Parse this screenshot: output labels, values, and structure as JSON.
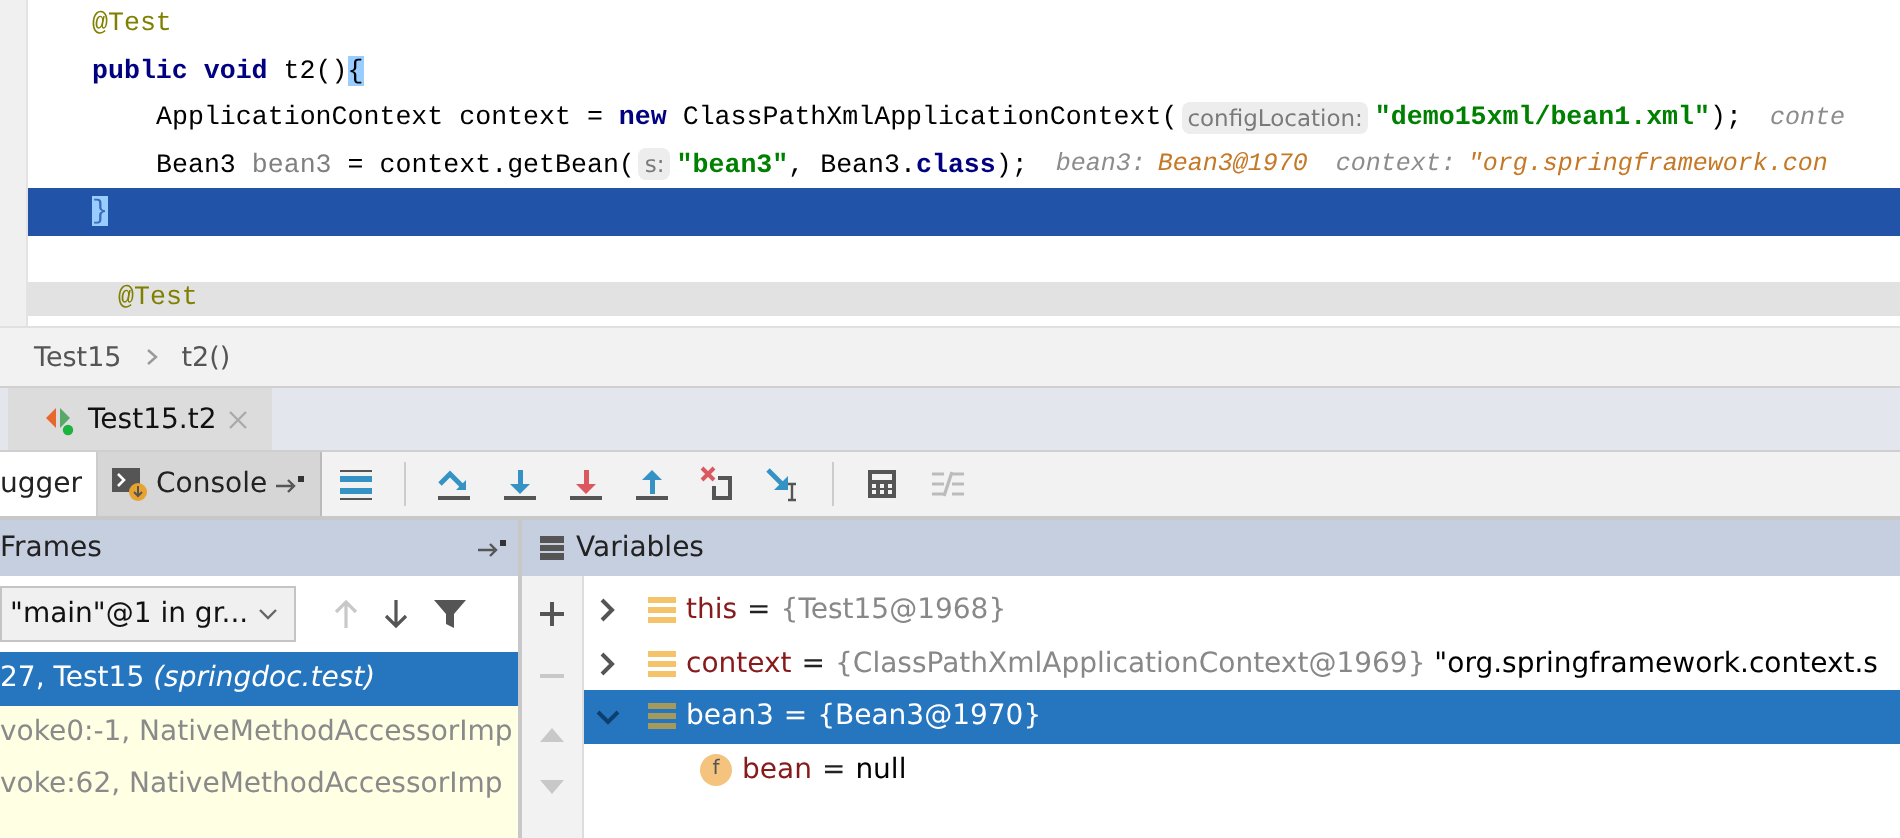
{
  "editor": {
    "lines": [
      {
        "selected": false,
        "tokens": [
          {
            "kind": "annotation",
            "text": "@Test"
          }
        ]
      },
      {
        "selected": false,
        "tokens": [
          {
            "kind": "keyword",
            "text": "public void"
          },
          {
            "kind": "plain",
            "text": " t2()"
          },
          {
            "kind": "brace",
            "text": "{"
          }
        ],
        "children": [
          {
            "selected": false,
            "tokens": [
              {
                "kind": "plain",
                "text": "ApplicationContext context = "
              },
              {
                "kind": "keyword",
                "text": "new"
              },
              {
                "kind": "plain",
                "text": " ClassPathXmlApplicationContext("
              },
              {
                "kind": "hint",
                "text": "configLocation:"
              },
              {
                "kind": "string",
                "text": "\"demo15xml/bean1.xml\""
              },
              {
                "kind": "plain",
                "text": ");"
              },
              {
                "kind": "debug-name",
                "text": "conte"
              }
            ]
          },
          {
            "selected": false,
            "tokens": [
              {
                "kind": "plain",
                "text": "Bean3 "
              },
              {
                "kind": "unused",
                "text": "bean3"
              },
              {
                "kind": "plain",
                "text": " = context.getBean("
              },
              {
                "kind": "hint",
                "text": "s:"
              },
              {
                "kind": "string",
                "text": "\"bean3\""
              },
              {
                "kind": "plain",
                "text": ", Bean3."
              },
              {
                "kind": "keyword",
                "text": "class"
              },
              {
                "kind": "plain",
                "text": ");"
              },
              {
                "kind": "debug-name",
                "text": "bean3:"
              },
              {
                "kind": "debug-value",
                "text": "Bean3@1970"
              },
              {
                "kind": "debug-name",
                "text": "context:"
              },
              {
                "kind": "debug-value",
                "text": "\"org.springframework.con"
              }
            ]
          }
        ]
      },
      {
        "selected": true,
        "tokens": [
          {
            "kind": "brace",
            "text": "}"
          }
        ]
      },
      {
        "selected": false,
        "blank_before": true,
        "tokens": [
          {
            "kind": "annotation",
            "text": "@Test"
          }
        ]
      }
    ]
  },
  "breadcrumbs": [
    "Test15",
    "t2()"
  ],
  "run_tabs": [
    {
      "label": "Test15.t2",
      "selected": true
    }
  ],
  "debugger": {
    "tabs": [
      {
        "label": "ugger",
        "selected": true
      },
      {
        "label": "Console",
        "selected": false
      }
    ],
    "frames": {
      "title": "Frames",
      "thread": "\"main\"@1 in gr...",
      "items": [
        {
          "text": "27, Test15 *(springdoc.test)*",
          "selected": true
        },
        {
          "text": "voke0:-1, NativeMethodAccessorImp",
          "selected": false
        },
        {
          "text": "voke:62, NativeMethodAccessorImp",
          "selected": false
        }
      ]
    },
    "variables": {
      "title": "Variables",
      "items": [
        {
          "kind": "object",
          "name": "this",
          "operator": "=",
          "value": "{Test15@1968}",
          "expanded": false,
          "selected": false
        },
        {
          "kind": "object",
          "name": "context",
          "operator": "=",
          "value": "{ClassPathXmlApplicationContext@1969}",
          "extra": "\"org.springframework.context.s",
          "expanded": false,
          "selected": false
        },
        {
          "kind": "object",
          "name": "bean3",
          "operator": "=",
          "value": "{Bean3@1970}",
          "expanded": true,
          "selected": true,
          "children": [
            {
              "kind": "field",
              "icon_letter": "f",
              "name": "bean",
              "operator": "=",
              "value": "null",
              "selected": false
            }
          ]
        }
      ]
    }
  }
}
